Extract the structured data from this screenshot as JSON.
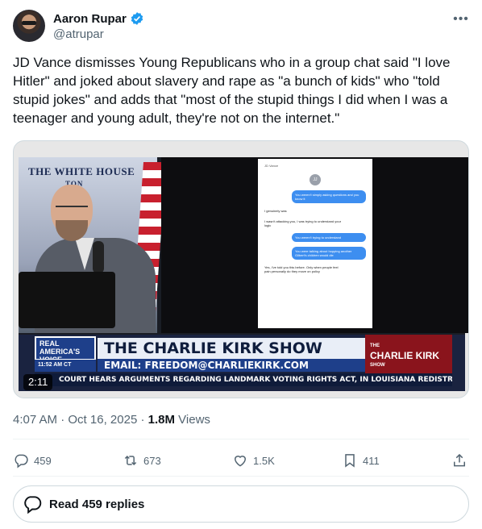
{
  "author": {
    "name": "Aaron Rupar",
    "handle": "@atrupar"
  },
  "tweet": {
    "text": "JD Vance dismisses Young Republicans who in a group chat said \"I love Hitler\" and joked about slavery and rape as \"a bunch of kids\" who \"told stupid jokes\" and adds that \"most of the stupid things I did when I was a teenager and young adult, they're not on the internet.\""
  },
  "video": {
    "duration": "2:11",
    "backdrop_text": "THE WHITE HOUSE",
    "backdrop_sub": "TON",
    "phone": {
      "header": "JD Vance",
      "contact": "JJ",
      "messages": [
        {
          "dir": "out",
          "text": "You weren't simply asking questions and you know it"
        },
        {
          "dir": "in",
          "text": "I genuinely was"
        },
        {
          "dir": "in",
          "text": "I wasn't attacking you, I was trying to understand your logic"
        },
        {
          "dir": "out",
          "text": "You weren't trying to understand"
        },
        {
          "dir": "out",
          "text": "You were talking about hopping another Gilbert's children would die"
        },
        {
          "dir": "in",
          "text": "Yes, I've told you this before. Only when people feel pain personally do they move on policy"
        }
      ]
    },
    "lower_third": {
      "network_logo": "REAL AMERICA'S VOICE",
      "time": "11:52 AM CT",
      "show_title": "THE CHARLIE KIRK SHOW",
      "email": "EMAIL: FREEDOM@CHARLIEKIRK.COM",
      "show_logo_top": "THE",
      "show_logo_main": "CHARLIE KIRK",
      "show_logo_bottom": "SHOW",
      "ticker": "COURT HEARS ARGUMENTS REGARDING LANDMARK VOTING RIGHTS ACT, IN LOUISIANA REDISTRICTING"
    }
  },
  "meta": {
    "time": "4:07 AM",
    "dot": " · ",
    "date": "Oct 16, 2025",
    "views_count": "1.8M",
    "views_label": " Views"
  },
  "actions": {
    "replies": "459",
    "reposts": "673",
    "likes": "1.5K",
    "bookmarks": "411"
  },
  "read_replies": "Read 459 replies",
  "colors": {
    "verified": "#1d9bf0",
    "text_secondary": "#536471"
  }
}
